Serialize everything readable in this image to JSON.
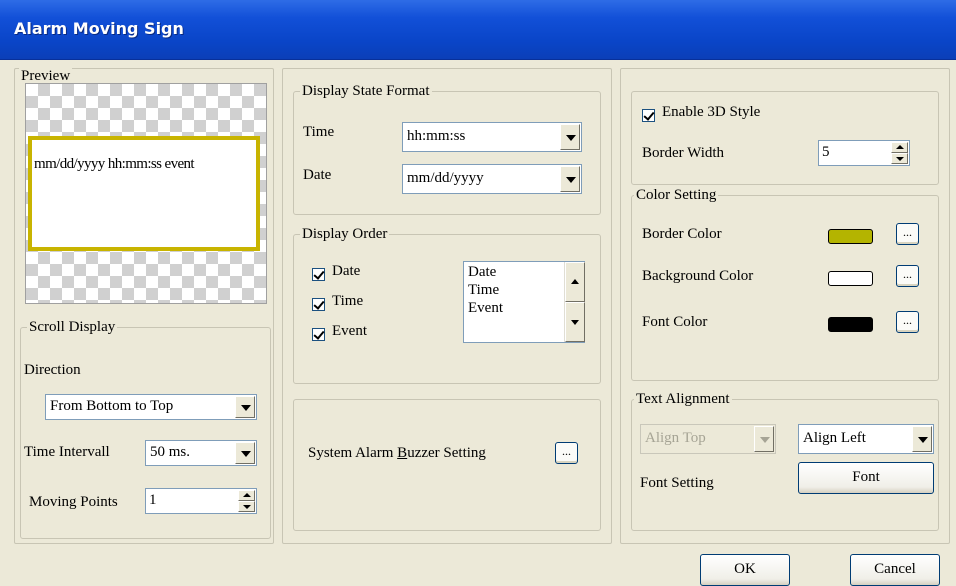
{
  "window": {
    "title": "Alarm Moving Sign"
  },
  "preview": {
    "legend": "Preview",
    "sample_text": "mm/dd/yyyy hh:mm:ss event",
    "border_color": "#c8b400"
  },
  "scroll_display": {
    "legend": "Scroll Display",
    "direction_label": "Direction",
    "direction_value": "From Bottom to Top",
    "interval_label": "Time Intervall",
    "interval_value": "50 ms.",
    "points_label": "Moving Points",
    "points_value": "1"
  },
  "display_state_format": {
    "legend": "Display State Format",
    "time_label": "Time",
    "time_value": "hh:mm:ss",
    "date_label": "Date",
    "date_value": "mm/dd/yyyy"
  },
  "display_order": {
    "legend": "Display Order",
    "checks": [
      {
        "label": "Date",
        "checked": true
      },
      {
        "label": "Time",
        "checked": true
      },
      {
        "label": "Event",
        "checked": true
      }
    ],
    "list": [
      "Date",
      "Time",
      "Event"
    ]
  },
  "buzzer": {
    "label_pre": "System Alarm ",
    "label_ul": "B",
    "label_post": "uzzer Setting",
    "button": "..."
  },
  "style": {
    "enable_3d_label": "Enable 3D Style",
    "enable_3d_checked": true,
    "border_width_label": "Border Width",
    "border_width_value": "5"
  },
  "color_setting": {
    "legend": "Color Setting",
    "items": [
      {
        "label": "Border Color",
        "color": "#b4b400",
        "button": "..."
      },
      {
        "label": "Background Color",
        "color": "#ffffff",
        "button": "..."
      },
      {
        "label": "Font Color",
        "color": "#000000",
        "button": "..."
      }
    ]
  },
  "text_alignment": {
    "legend": "Text Alignment",
    "vertical_value": "Align Top",
    "horizontal_value": "Align Left",
    "font_setting_label": "Font Setting",
    "font_button": "Font"
  },
  "footer": {
    "ok": "OK",
    "cancel": "Cancel"
  }
}
